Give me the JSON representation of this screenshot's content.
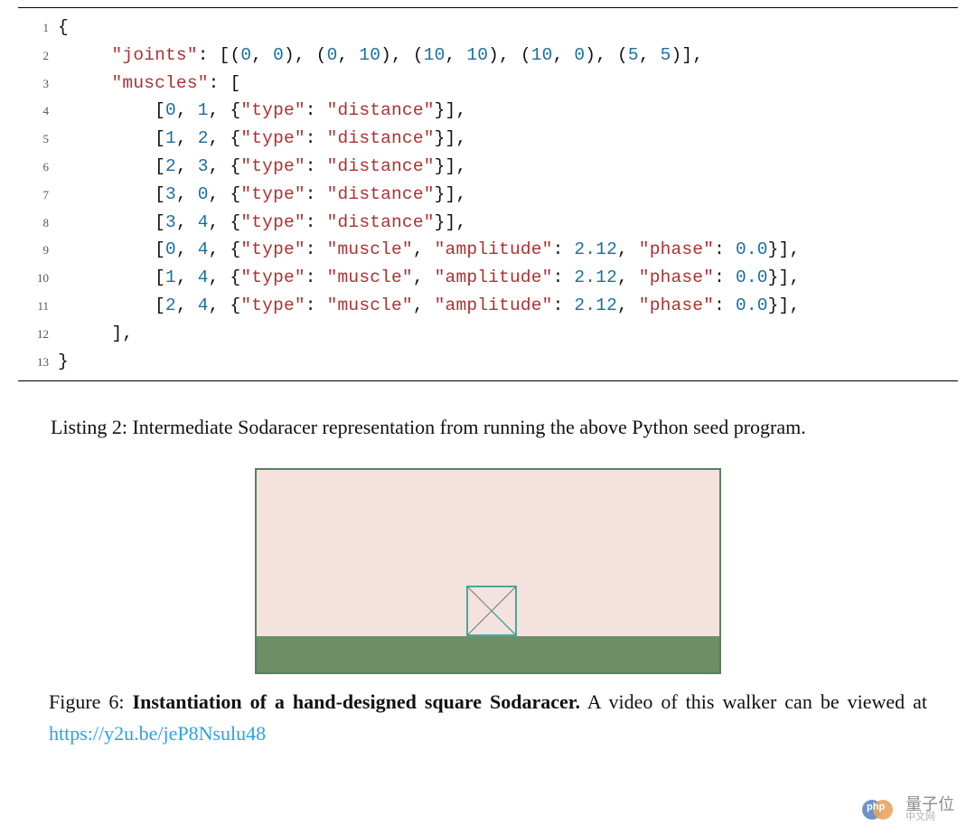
{
  "code": {
    "lines": [
      {
        "num": "1",
        "tokens": [
          {
            "c": "p",
            "t": "{"
          }
        ]
      },
      {
        "num": "2",
        "tokens": [
          {
            "c": "p",
            "t": "     "
          },
          {
            "c": "s",
            "t": "\"joints\""
          },
          {
            "c": "p",
            "t": ": [("
          },
          {
            "c": "n",
            "t": "0"
          },
          {
            "c": "p",
            "t": ", "
          },
          {
            "c": "n",
            "t": "0"
          },
          {
            "c": "p",
            "t": "), ("
          },
          {
            "c": "n",
            "t": "0"
          },
          {
            "c": "p",
            "t": ", "
          },
          {
            "c": "n",
            "t": "10"
          },
          {
            "c": "p",
            "t": "), ("
          },
          {
            "c": "n",
            "t": "10"
          },
          {
            "c": "p",
            "t": ", "
          },
          {
            "c": "n",
            "t": "10"
          },
          {
            "c": "p",
            "t": "), ("
          },
          {
            "c": "n",
            "t": "10"
          },
          {
            "c": "p",
            "t": ", "
          },
          {
            "c": "n",
            "t": "0"
          },
          {
            "c": "p",
            "t": "), ("
          },
          {
            "c": "n",
            "t": "5"
          },
          {
            "c": "p",
            "t": ", "
          },
          {
            "c": "n",
            "t": "5"
          },
          {
            "c": "p",
            "t": ")],"
          }
        ]
      },
      {
        "num": "3",
        "tokens": [
          {
            "c": "p",
            "t": "     "
          },
          {
            "c": "s",
            "t": "\"muscles\""
          },
          {
            "c": "p",
            "t": ": ["
          }
        ]
      },
      {
        "num": "4",
        "tokens": [
          {
            "c": "p",
            "t": "         ["
          },
          {
            "c": "n",
            "t": "0"
          },
          {
            "c": "p",
            "t": ", "
          },
          {
            "c": "n",
            "t": "1"
          },
          {
            "c": "p",
            "t": ", {"
          },
          {
            "c": "s",
            "t": "\"type\""
          },
          {
            "c": "p",
            "t": ": "
          },
          {
            "c": "s",
            "t": "\"distance\""
          },
          {
            "c": "p",
            "t": "}],"
          }
        ]
      },
      {
        "num": "5",
        "tokens": [
          {
            "c": "p",
            "t": "         ["
          },
          {
            "c": "n",
            "t": "1"
          },
          {
            "c": "p",
            "t": ", "
          },
          {
            "c": "n",
            "t": "2"
          },
          {
            "c": "p",
            "t": ", {"
          },
          {
            "c": "s",
            "t": "\"type\""
          },
          {
            "c": "p",
            "t": ": "
          },
          {
            "c": "s",
            "t": "\"distance\""
          },
          {
            "c": "p",
            "t": "}],"
          }
        ]
      },
      {
        "num": "6",
        "tokens": [
          {
            "c": "p",
            "t": "         ["
          },
          {
            "c": "n",
            "t": "2"
          },
          {
            "c": "p",
            "t": ", "
          },
          {
            "c": "n",
            "t": "3"
          },
          {
            "c": "p",
            "t": ", {"
          },
          {
            "c": "s",
            "t": "\"type\""
          },
          {
            "c": "p",
            "t": ": "
          },
          {
            "c": "s",
            "t": "\"distance\""
          },
          {
            "c": "p",
            "t": "}],"
          }
        ]
      },
      {
        "num": "7",
        "tokens": [
          {
            "c": "p",
            "t": "         ["
          },
          {
            "c": "n",
            "t": "3"
          },
          {
            "c": "p",
            "t": ", "
          },
          {
            "c": "n",
            "t": "0"
          },
          {
            "c": "p",
            "t": ", {"
          },
          {
            "c": "s",
            "t": "\"type\""
          },
          {
            "c": "p",
            "t": ": "
          },
          {
            "c": "s",
            "t": "\"distance\""
          },
          {
            "c": "p",
            "t": "}],"
          }
        ]
      },
      {
        "num": "8",
        "tokens": [
          {
            "c": "p",
            "t": "         ["
          },
          {
            "c": "n",
            "t": "3"
          },
          {
            "c": "p",
            "t": ", "
          },
          {
            "c": "n",
            "t": "4"
          },
          {
            "c": "p",
            "t": ", {"
          },
          {
            "c": "s",
            "t": "\"type\""
          },
          {
            "c": "p",
            "t": ": "
          },
          {
            "c": "s",
            "t": "\"distance\""
          },
          {
            "c": "p",
            "t": "}],"
          }
        ]
      },
      {
        "num": "9",
        "tokens": [
          {
            "c": "p",
            "t": "         ["
          },
          {
            "c": "n",
            "t": "0"
          },
          {
            "c": "p",
            "t": ", "
          },
          {
            "c": "n",
            "t": "4"
          },
          {
            "c": "p",
            "t": ", {"
          },
          {
            "c": "s",
            "t": "\"type\""
          },
          {
            "c": "p",
            "t": ": "
          },
          {
            "c": "s",
            "t": "\"muscle\""
          },
          {
            "c": "p",
            "t": ", "
          },
          {
            "c": "s",
            "t": "\"amplitude\""
          },
          {
            "c": "p",
            "t": ": "
          },
          {
            "c": "n",
            "t": "2.12"
          },
          {
            "c": "p",
            "t": ", "
          },
          {
            "c": "s",
            "t": "\"phase\""
          },
          {
            "c": "p",
            "t": ": "
          },
          {
            "c": "n",
            "t": "0.0"
          },
          {
            "c": "p",
            "t": "}],"
          }
        ]
      },
      {
        "num": "10",
        "tokens": [
          {
            "c": "p",
            "t": "         ["
          },
          {
            "c": "n",
            "t": "1"
          },
          {
            "c": "p",
            "t": ", "
          },
          {
            "c": "n",
            "t": "4"
          },
          {
            "c": "p",
            "t": ", {"
          },
          {
            "c": "s",
            "t": "\"type\""
          },
          {
            "c": "p",
            "t": ": "
          },
          {
            "c": "s",
            "t": "\"muscle\""
          },
          {
            "c": "p",
            "t": ", "
          },
          {
            "c": "s",
            "t": "\"amplitude\""
          },
          {
            "c": "p",
            "t": ": "
          },
          {
            "c": "n",
            "t": "2.12"
          },
          {
            "c": "p",
            "t": ", "
          },
          {
            "c": "s",
            "t": "\"phase\""
          },
          {
            "c": "p",
            "t": ": "
          },
          {
            "c": "n",
            "t": "0.0"
          },
          {
            "c": "p",
            "t": "}],"
          }
        ]
      },
      {
        "num": "11",
        "tokens": [
          {
            "c": "p",
            "t": "         ["
          },
          {
            "c": "n",
            "t": "2"
          },
          {
            "c": "p",
            "t": ", "
          },
          {
            "c": "n",
            "t": "4"
          },
          {
            "c": "p",
            "t": ", {"
          },
          {
            "c": "s",
            "t": "\"type\""
          },
          {
            "c": "p",
            "t": ": "
          },
          {
            "c": "s",
            "t": "\"muscle\""
          },
          {
            "c": "p",
            "t": ", "
          },
          {
            "c": "s",
            "t": "\"amplitude\""
          },
          {
            "c": "p",
            "t": ": "
          },
          {
            "c": "n",
            "t": "2.12"
          },
          {
            "c": "p",
            "t": ", "
          },
          {
            "c": "s",
            "t": "\"phase\""
          },
          {
            "c": "p",
            "t": ": "
          },
          {
            "c": "n",
            "t": "0.0"
          },
          {
            "c": "p",
            "t": "}],"
          }
        ]
      },
      {
        "num": "12",
        "tokens": [
          {
            "c": "p",
            "t": "     ],"
          }
        ]
      },
      {
        "num": "13",
        "tokens": [
          {
            "c": "p",
            "t": "}"
          }
        ]
      }
    ]
  },
  "listing_caption": "Listing 2:  Intermediate Sodaracer representation from running the above Python seed program.",
  "figure": {
    "label": "Figure 6: ",
    "title_bold": "Instantiation of a hand-designed square Sodaracer.",
    "tail_plain": "  A video of this walker can be viewed at ",
    "link_text": "https://y2u.be/jeP8Nsulu48",
    "link_href": "https://y2u.be/jeP8Nsulu48"
  },
  "chart_data": {
    "type": "table",
    "description": "Sodaracer intermediate representation",
    "joints": [
      [
        0,
        0
      ],
      [
        0,
        10
      ],
      [
        10,
        10
      ],
      [
        10,
        0
      ],
      [
        5,
        5
      ]
    ],
    "muscles": [
      {
        "a": 0,
        "b": 1,
        "type": "distance"
      },
      {
        "a": 1,
        "b": 2,
        "type": "distance"
      },
      {
        "a": 2,
        "b": 3,
        "type": "distance"
      },
      {
        "a": 3,
        "b": 0,
        "type": "distance"
      },
      {
        "a": 3,
        "b": 4,
        "type": "distance"
      },
      {
        "a": 0,
        "b": 4,
        "type": "muscle",
        "amplitude": 2.12,
        "phase": 0.0
      },
      {
        "a": 1,
        "b": 4,
        "type": "muscle",
        "amplitude": 2.12,
        "phase": 0.0
      },
      {
        "a": 2,
        "b": 4,
        "type": "muscle",
        "amplitude": 2.12,
        "phase": 0.0
      }
    ]
  },
  "watermark": {
    "brand": "量子位",
    "sub": "中文网"
  }
}
